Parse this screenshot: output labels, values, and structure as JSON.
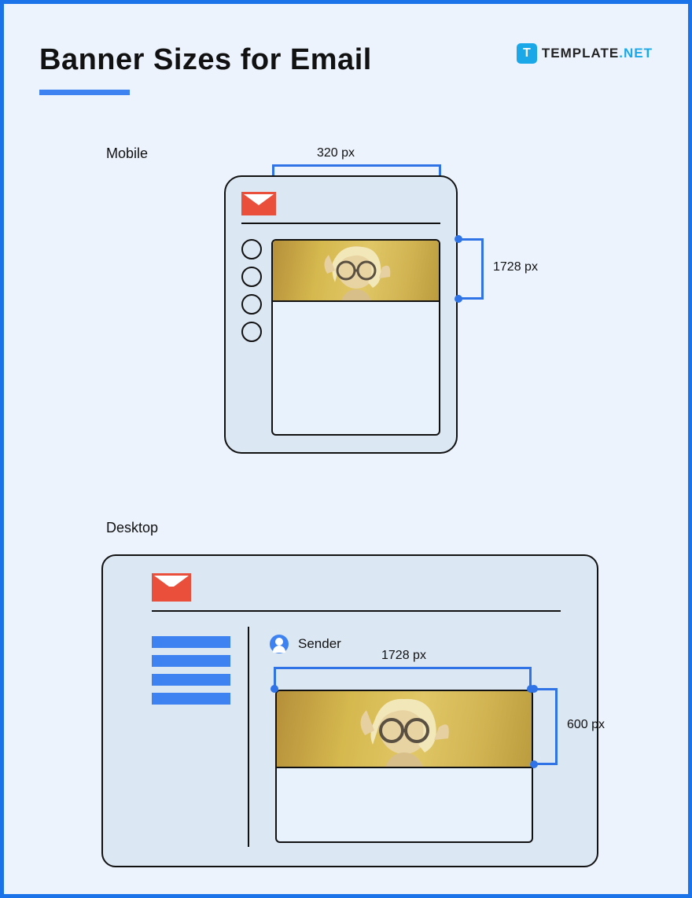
{
  "header": {
    "title": "Banner Sizes for Email",
    "brand_prefix": "TEMPLATE",
    "brand_suffix": ".NET",
    "brand_logo_letter": "T"
  },
  "mobile": {
    "label": "Mobile",
    "width_label": "320 px",
    "height_label": "1728 px"
  },
  "desktop": {
    "label": "Desktop",
    "sender_label": "Sender",
    "width_label": "1728 px",
    "height_label": "600 px"
  }
}
